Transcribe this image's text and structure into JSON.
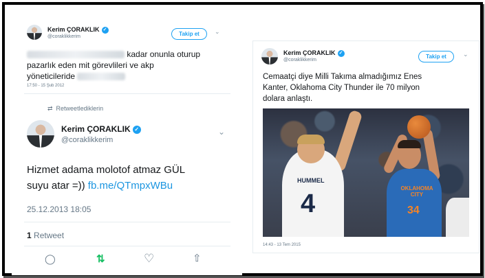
{
  "left_tweet_top": {
    "author": "Kerim ÇORAKLIK",
    "handle": "@coraklikkerim",
    "follow_label": "Takip et",
    "text_line1_suffix": "kadar onunla oturup",
    "text_line2": "pazarlık eden mit görevlileri ve akp",
    "text_line3_prefix": "yöneticileride",
    "timestamp": "17:50 - 15 Şub 2012",
    "retweeted_label": "Retweetlediklerin"
  },
  "left_tweet_main": {
    "author": "Kerim ÇORAKLIK",
    "handle": "@coraklikkerim",
    "text_line1": "Hizmet adama molotof atmaz GÜL",
    "text_line2_prefix": "suyu atar =))",
    "text_link": "fb.me/QTmpxWBu",
    "date": "25.12.2013 18:05",
    "retweet_count": "1",
    "retweet_label": "Retweet"
  },
  "right_tweet": {
    "author": "Kerim ÇORAKLIK",
    "handle": "@coraklikkerim",
    "follow_label": "Takip et",
    "text_line1": "Cemaatçi diye Milli Takıma almadığımız Enes",
    "text_line2": "Kanter, Oklahoma City Thunder ile 70 milyon",
    "text_line3": "dolara anlaştı.",
    "timestamp": "14:43 - 13 Tem 2015",
    "photo_jersey_left_name": "HUMMEL",
    "photo_jersey_left_number": "4",
    "photo_jersey_right_text": "OKLAHOMA CITY",
    "photo_jersey_right_number": "34"
  },
  "icons": {
    "verified": "✓",
    "chevron": "⌄",
    "retweet_small": "⇄",
    "reply": "◯",
    "retweet": "⇅",
    "like": "♡",
    "share": "⇧"
  },
  "colors": {
    "accent": "#1da1f2",
    "retweet_green": "#17bf63",
    "link": "#1b95e0",
    "muted": "#657786"
  }
}
